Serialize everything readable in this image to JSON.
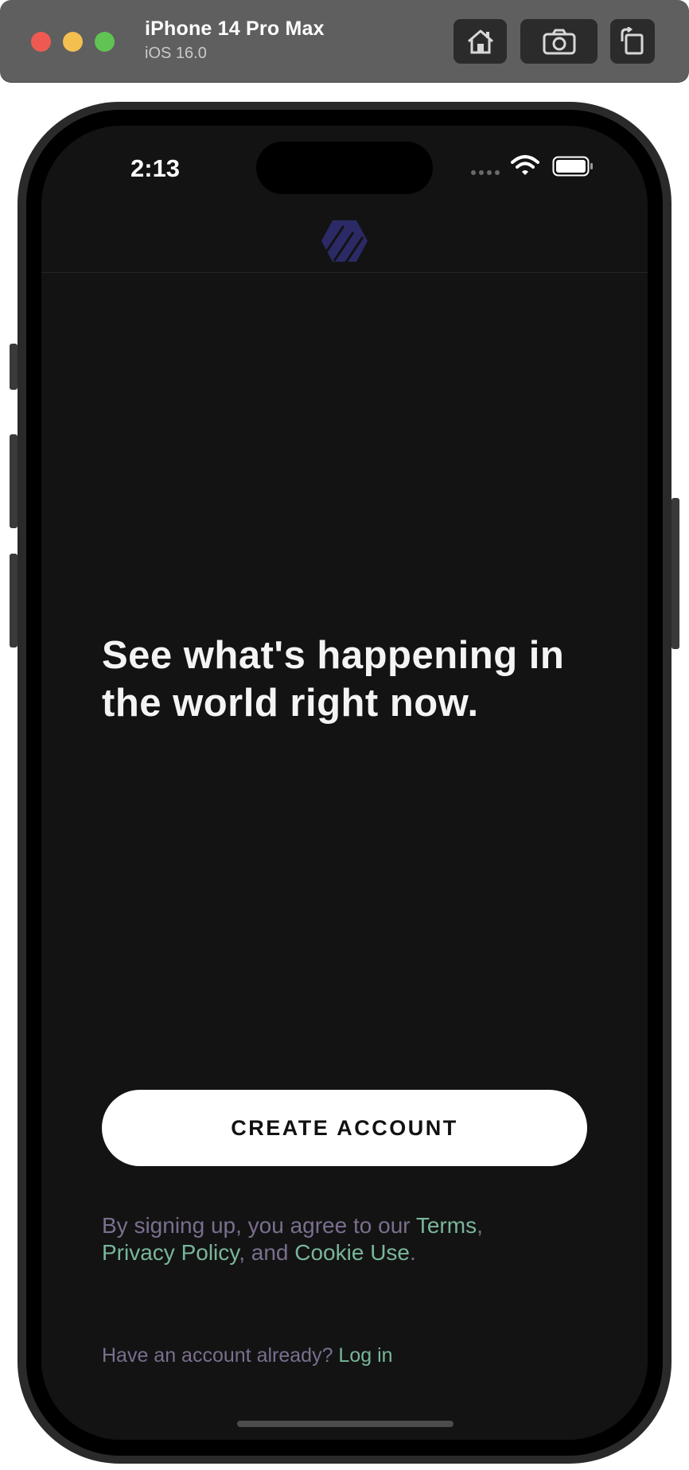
{
  "simulator": {
    "device_name": "iPhone 14 Pro Max",
    "os_version": "iOS 16.0",
    "toolbar_icons": [
      "home-icon",
      "screenshot-icon",
      "rotate-icon"
    ]
  },
  "status_bar": {
    "time": "2:13",
    "icons": [
      "cellular-icon",
      "wifi-icon",
      "battery-icon"
    ]
  },
  "header": {
    "logo_icon": "hexagon-logo-icon",
    "logo_color": "#2c2a66"
  },
  "main": {
    "headline": "See what's happening in the world right now.",
    "create_account_label": "CREATE ACCOUNT",
    "legal": {
      "prefix": "By signing up, you agree to our ",
      "terms": "Terms",
      "comma": ",",
      "privacy": "Privacy Policy",
      "and": ", and ",
      "cookie": "Cookie Use",
      "period": "."
    },
    "login": {
      "prompt": "Have an account already? ",
      "link": "Log in"
    }
  },
  "colors": {
    "background": "#131313",
    "link": "#79b69a",
    "muted_text": "#7a6f8e",
    "button_bg": "#ffffff"
  }
}
